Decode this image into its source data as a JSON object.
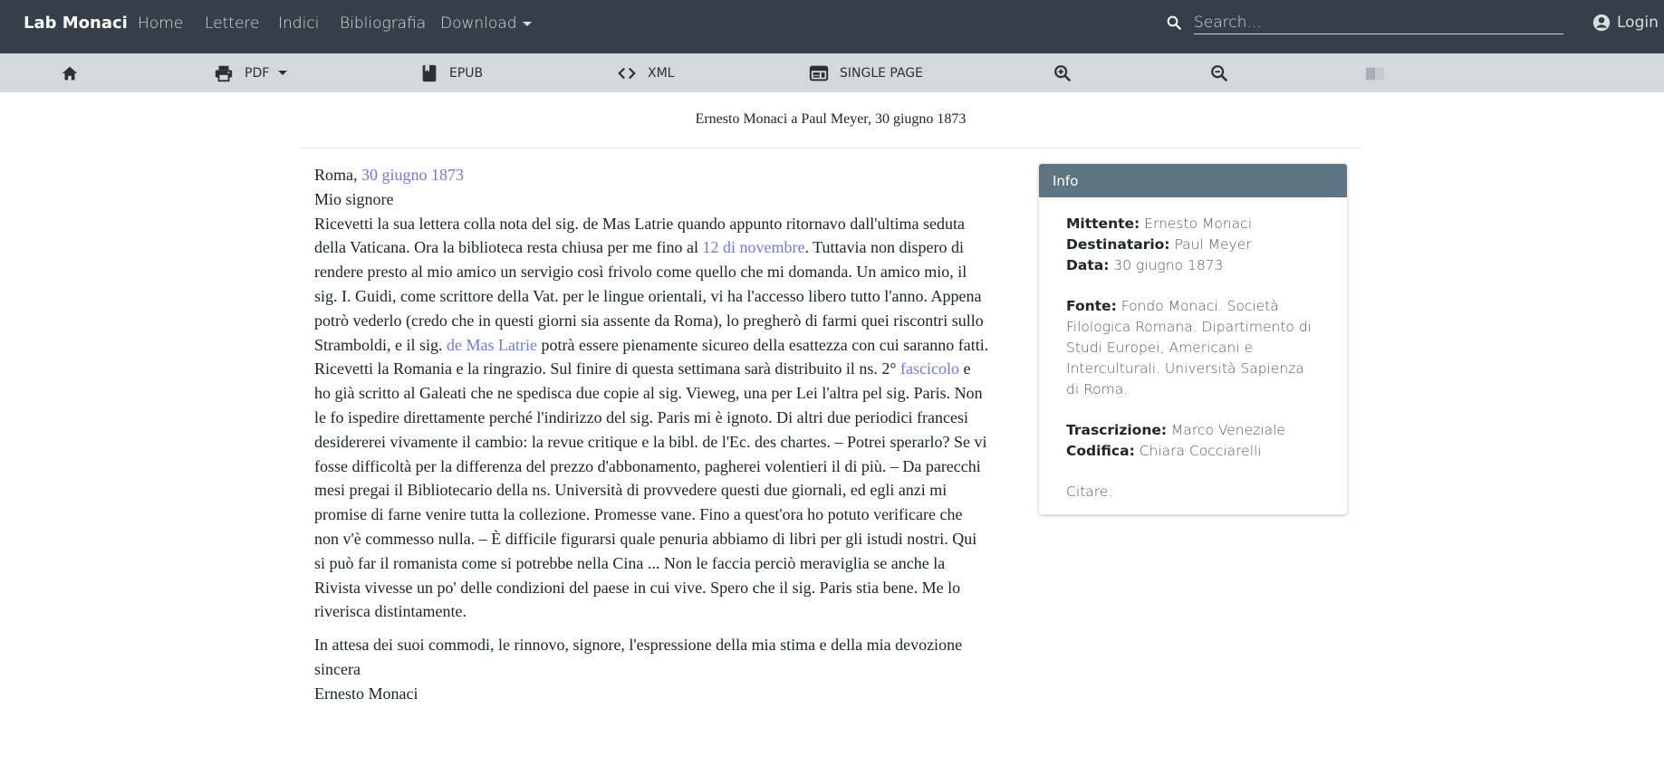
{
  "navbar": {
    "brand": "Lab Monaci",
    "links": [
      "Home",
      "Lettere",
      "Indici",
      "Bibliografia"
    ],
    "download_label": "Download",
    "search_placeholder": "Search...",
    "login_label": "Login"
  },
  "toolbar": {
    "pdf": "PDF",
    "epub": "EPUB",
    "xml": "XML",
    "single_page": "SINGLE PAGE"
  },
  "document": {
    "title": "Ernesto Monaci a Paul Meyer, 30 giugno 1873",
    "place": "Roma, ",
    "date_link": "30 giugno 1873",
    "salutation": "Mio signore",
    "body_1": "Ricevetti la sua lettera colla nota del sig. de Mas Latrie quando appunto ritornavo dall'ultima seduta della Vaticana. Ora la biblioteca resta chiusa per me fino al ",
    "link_november": "12 di novembre",
    "body_2": ". Tuttavia non dispero di rendere presto al mio amico un servigio così frivolo come quello che mi domanda. Un amico mio, il sig. I. Guidi, come scrittore della Vat. per le lingue orientali, vi ha l'accesso libero tutto l'anno. Appena potrò vederlo (credo che in questi giorni sia assente da Roma), lo pregherò di farmi quei riscontri sullo Stramboldi, e il sig. ",
    "link_mas_latrie": "de Mas Latrie",
    "body_3": " potrà essere pienamente sicureo della esattezza con cui saranno fatti. Ricevetti la Romania e la ringrazio. Sul finire di questa settimana sarà distribuito il ns. 2° ",
    "link_fascicolo": "fascicolo",
    "body_4": " e ho già scritto al Galeati che ne spedisca due copie al sig. Vieweg, una per Lei l'altra pel sig. Paris. Non le fo ispedire direttamente perché l'indirizzo del sig. Paris mi è ignoto. Di altri due periodici francesi desidererei vivamente il cambio: la revue critique e la bibl. de l'Ec. des chartes. – Potrei sperarlo? Se vi fosse difficoltà per la differenza del prezzo d'abbonamento, pagherei volentieri il di più. – Da parecchi mesi pregai il Bibliotecario della ns. Università di provvedere questi due giornali, ed egli anzi mi promise di farne venire tutta la collezione. Promesse vane. Fino a quest'ora ho potuto verificare che non v'è commesso nulla. – È difficile figurarsi quale penuria abbiamo di libri per gli istudi nostri. Qui si può far il romanista come si potrebbe nella Cina ... Non le faccia perciò meraviglia se anche la Rivista vivesse un po' delle condizioni del paese in cui vive. Spero che il sig. Paris stia bene. Me lo riverisca distintamente.",
    "closing": "In attesa dei suoi commodi, le rinnovo, signore, l'espressione della mia stima e della mia devozione sincera",
    "signature": "Ernesto Monaci"
  },
  "info": {
    "header": "Info",
    "mittente_label": "Mittente:",
    "mittente": "Ernesto Monaci",
    "destinatario_label": "Destinatario:",
    "destinatario": "Paul Meyer",
    "data_label": "Data:",
    "data": "30 giugno 1873",
    "fonte_label": "Fonte:",
    "fonte": "Fondo Monaci. Società Filologica Romana. Dipartimento di Studi Europei, Americani e Interculturali. Università Sapienza di Roma.",
    "trascrizione_label": "Trascrizione:",
    "trascrizione": "Marco Veneziale",
    "codifica_label": "Codifica:",
    "codifica": "Chiara Cocciarelli",
    "citare_label": "Citare:"
  },
  "colors": {
    "navbar": "#343f48",
    "toolbar": "#d2d9df",
    "link": "#6f79e6",
    "info_header": "#5e7584"
  },
  "icons": [
    "search-icon",
    "account-icon",
    "home-icon",
    "printer-icon",
    "book-icon",
    "code-icon",
    "web-window-icon",
    "zoom-in-icon",
    "zoom-out-icon",
    "book-open-icon"
  ]
}
